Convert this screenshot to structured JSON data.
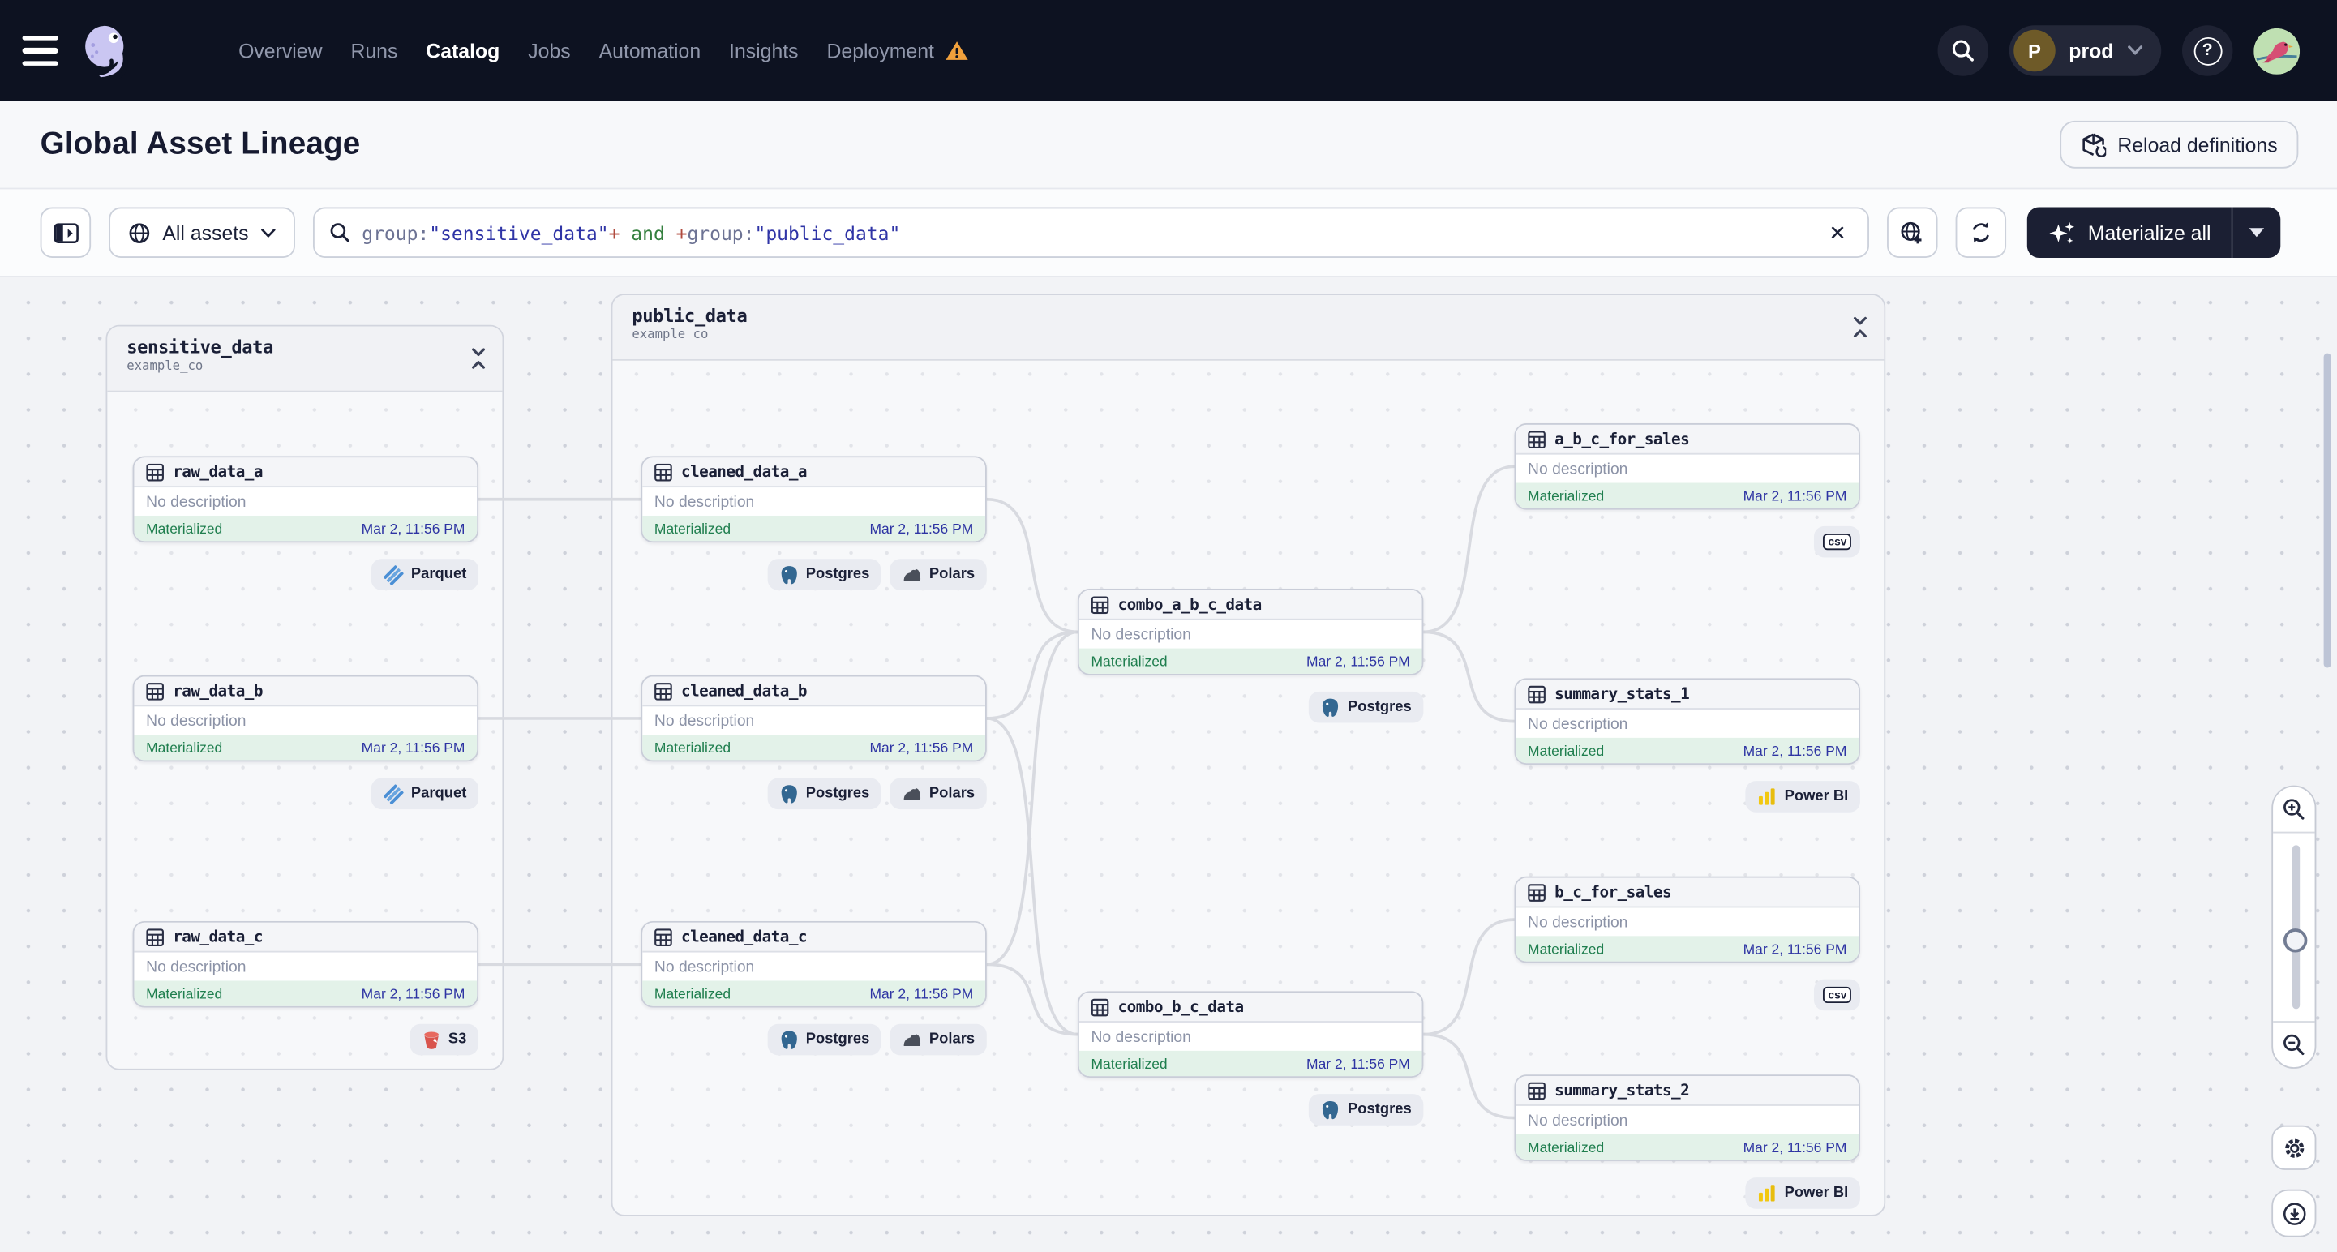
{
  "nav": {
    "menu": [
      {
        "label": "Overview"
      },
      {
        "label": "Runs"
      },
      {
        "label": "Catalog"
      },
      {
        "label": "Jobs"
      },
      {
        "label": "Automation"
      },
      {
        "label": "Insights"
      },
      {
        "label": "Deployment",
        "warning": true
      }
    ],
    "active_item": "Catalog",
    "environment": {
      "initial": "P",
      "name": "prod"
    }
  },
  "header": {
    "title": "Global Asset Lineage",
    "reload_button": "Reload definitions"
  },
  "toolbar": {
    "scope_button": "All assets",
    "search_query": [
      {
        "t": "group:",
        "c": "#6d7394"
      },
      {
        "t": "\"sensitive_data\"",
        "c": "#2f34a6"
      },
      {
        "t": "+",
        "c": "#b04a3d"
      },
      {
        "t": " and ",
        "c": "#35803f"
      },
      {
        "t": "+",
        "c": "#b04a3d"
      },
      {
        "t": "group:",
        "c": "#6d7394"
      },
      {
        "t": "\"public_data\"",
        "c": "#2f34a6"
      }
    ],
    "materialize_button": "Materialize all"
  },
  "graph": {
    "groups": [
      {
        "id": "sensitive_data",
        "title": "sensitive_data",
        "subtitle": "example_co"
      },
      {
        "id": "public_data",
        "title": "public_data",
        "subtitle": "example_co"
      }
    ],
    "nodes": [
      {
        "id": "raw_data_a",
        "name": "raw_data_a",
        "description": "No description",
        "status": "Materialized",
        "timestamp": "Mar 2, 11:56 PM",
        "badges": [
          {
            "icon": "parquet-icon",
            "label": "Parquet"
          }
        ]
      },
      {
        "id": "raw_data_b",
        "name": "raw_data_b",
        "description": "No description",
        "status": "Materialized",
        "timestamp": "Mar 2, 11:56 PM",
        "badges": [
          {
            "icon": "parquet-icon",
            "label": "Parquet"
          }
        ]
      },
      {
        "id": "raw_data_c",
        "name": "raw_data_c",
        "description": "No description",
        "status": "Materialized",
        "timestamp": "Mar 2, 11:56 PM",
        "badges": [
          {
            "icon": "s3-icon",
            "label": "S3"
          }
        ]
      },
      {
        "id": "cleaned_data_a",
        "name": "cleaned_data_a",
        "description": "No description",
        "status": "Materialized",
        "timestamp": "Mar 2, 11:56 PM",
        "badges": [
          {
            "icon": "postgres-icon",
            "label": "Postgres"
          },
          {
            "icon": "polars-icon",
            "label": "Polars"
          }
        ]
      },
      {
        "id": "cleaned_data_b",
        "name": "cleaned_data_b",
        "description": "No description",
        "status": "Materialized",
        "timestamp": "Mar 2, 11:56 PM",
        "badges": [
          {
            "icon": "postgres-icon",
            "label": "Postgres"
          },
          {
            "icon": "polars-icon",
            "label": "Polars"
          }
        ]
      },
      {
        "id": "cleaned_data_c",
        "name": "cleaned_data_c",
        "description": "No description",
        "status": "Materialized",
        "timestamp": "Mar 2, 11:56 PM",
        "badges": [
          {
            "icon": "postgres-icon",
            "label": "Postgres"
          },
          {
            "icon": "polars-icon",
            "label": "Polars"
          }
        ]
      },
      {
        "id": "combo_a_b_c_data",
        "name": "combo_a_b_c_data",
        "description": "No description",
        "status": "Materialized",
        "timestamp": "Mar 2, 11:56 PM",
        "badges": [
          {
            "icon": "postgres-icon",
            "label": "Postgres"
          }
        ]
      },
      {
        "id": "combo_b_c_data",
        "name": "combo_b_c_data",
        "description": "No description",
        "status": "Materialized",
        "timestamp": "Mar 2, 11:56 PM",
        "badges": [
          {
            "icon": "postgres-icon",
            "label": "Postgres"
          }
        ]
      },
      {
        "id": "a_b_c_for_sales",
        "name": "a_b_c_for_sales",
        "description": "No description",
        "status": "Materialized",
        "timestamp": "Mar 2, 11:56 PM",
        "badges": [
          {
            "icon": "csv-icon",
            "label": ""
          }
        ]
      },
      {
        "id": "summary_stats_1",
        "name": "summary_stats_1",
        "description": "No description",
        "status": "Materialized",
        "timestamp": "Mar 2, 11:56 PM",
        "badges": [
          {
            "icon": "powerbi-icon",
            "label": "Power BI"
          }
        ]
      },
      {
        "id": "b_c_for_sales",
        "name": "b_c_for_sales",
        "description": "No description",
        "status": "Materialized",
        "timestamp": "Mar 2, 11:56 PM",
        "badges": [
          {
            "icon": "csv-icon",
            "label": ""
          }
        ]
      },
      {
        "id": "summary_stats_2",
        "name": "summary_stats_2",
        "description": "No description",
        "status": "Materialized",
        "timestamp": "Mar 2, 11:56 PM",
        "badges": [
          {
            "icon": "powerbi-icon",
            "label": "Power BI"
          }
        ]
      }
    ],
    "edges": [
      [
        "raw_data_a",
        "cleaned_data_a"
      ],
      [
        "raw_data_b",
        "cleaned_data_b"
      ],
      [
        "raw_data_c",
        "cleaned_data_c"
      ],
      [
        "cleaned_data_a",
        "combo_a_b_c_data"
      ],
      [
        "cleaned_data_b",
        "combo_a_b_c_data"
      ],
      [
        "cleaned_data_c",
        "combo_a_b_c_data"
      ],
      [
        "cleaned_data_b",
        "combo_b_c_data"
      ],
      [
        "cleaned_data_c",
        "combo_b_c_data"
      ],
      [
        "combo_a_b_c_data",
        "a_b_c_for_sales"
      ],
      [
        "combo_a_b_c_data",
        "summary_stats_1"
      ],
      [
        "combo_b_c_data",
        "b_c_for_sales"
      ],
      [
        "combo_b_c_data",
        "summary_stats_2"
      ]
    ]
  },
  "colors": {
    "nav_bg": "#0d1221",
    "accent_dark": "#1b1f33",
    "status_green": "#1f7e4e",
    "status_green_bg": "#e3f2e9",
    "timestamp_indigo": "#2e34a3",
    "warning_orange": "#f0a03c",
    "canvas_bg": "#f2f3f6",
    "edge_gray": "#d8dae0"
  }
}
